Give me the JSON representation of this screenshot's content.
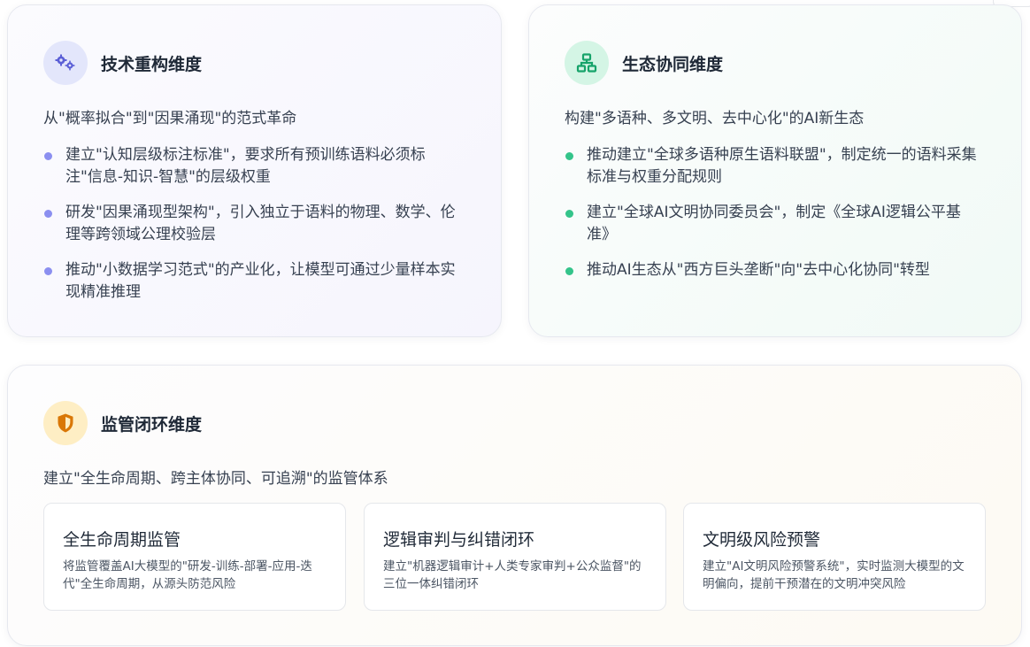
{
  "tech": {
    "icon": "gears-icon",
    "title": "技术重构维度",
    "subtitle": "从\"概率拟合\"到\"因果涌现\"的范式革命",
    "bullets": [
      "建立\"认知层级标注标准\"，要求所有预训练语料必须标注\"信息-知识-智慧\"的层级权重",
      "研发\"因果涌现型架构\"，引入独立于语料的物理、数学、伦理等跨领域公理校验层",
      "推动\"小数据学习范式\"的产业化，让模型可通过少量样本实现精准推理"
    ]
  },
  "eco": {
    "icon": "network-icon",
    "title": "生态协同维度",
    "subtitle": "构建\"多语种、多文明、去中心化\"的AI新生态",
    "bullets": [
      "推动建立\"全球多语种原生语料联盟\"，制定统一的语料采集标准与权重分配规则",
      "建立\"全球AI文明协同委员会\"，制定《全球AI逻辑公平基准》",
      "推动AI生态从\"西方巨头垄断\"向\"去中心化协同\"转型"
    ]
  },
  "reg": {
    "icon": "shield-icon",
    "title": "监管闭环维度",
    "subtitle": "建立\"全生命周期、跨主体协同、可追溯\"的监管体系",
    "boxes": [
      {
        "title": "全生命周期监管",
        "text": "将监管覆盖AI大模型的\"研发-训练-部署-应用-迭代\"全生命周期，从源头防范风险"
      },
      {
        "title": "逻辑审判与纠错闭环",
        "text": "建立\"机器逻辑审计+人类专家审判+公众监督\"的三位一体纠错闭环"
      },
      {
        "title": "文明级风险预警",
        "text": "建立\"AI文明风险预警系统\"，实时监测大模型的文明偏向，提前干预潜在的文明冲突风险"
      }
    ]
  },
  "colors": {
    "tech_accent": "#5b5fd6",
    "eco_accent": "#16a36a",
    "reg_accent": "#d97706"
  }
}
